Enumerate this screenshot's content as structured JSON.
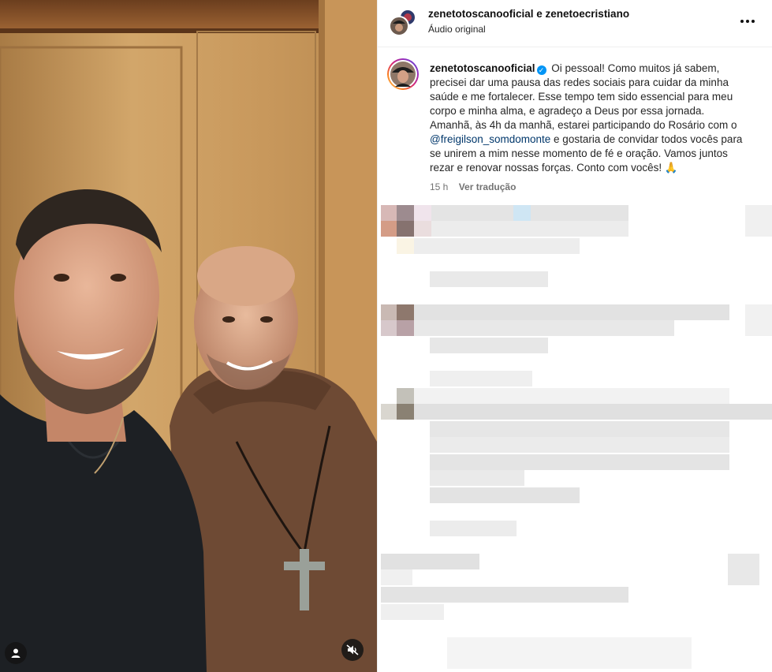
{
  "post": {
    "header": {
      "usernames": "zenetotoscanooficial e zenetoecristiano",
      "audio": "Áudio original"
    },
    "caption": {
      "username": "zenetotoscanooficial",
      "text_part1": "Oi pessoal! Como muitos já sabem, precisei dar uma pausa das redes sociais para cuidar da minha saúde e me fortalecer. Esse tempo tem sido essencial para meu corpo e minha alma, e agradeço a Deus por essa jornada. Amanhã, às 4h da manhã, estarei participando do Rosário com o",
      "mention": "@freigilson_somdomonte",
      "text_part2": "e gostaria de convidar todos vocês para se unirem a mim nesse momento de fé e oração. Vamos juntos rezar e renovar nossas forças. Conto com vocês! 🙏"
    },
    "meta": {
      "time": "15 h",
      "translate": "Ver tradução"
    },
    "icons": [
      "user-tag-icon",
      "muted-audio-icon",
      "more-options-icon",
      "verified-badge-icon"
    ],
    "colors": {
      "verified": "#0095f6",
      "mention": "#00376b",
      "meta": "#737373"
    }
  }
}
